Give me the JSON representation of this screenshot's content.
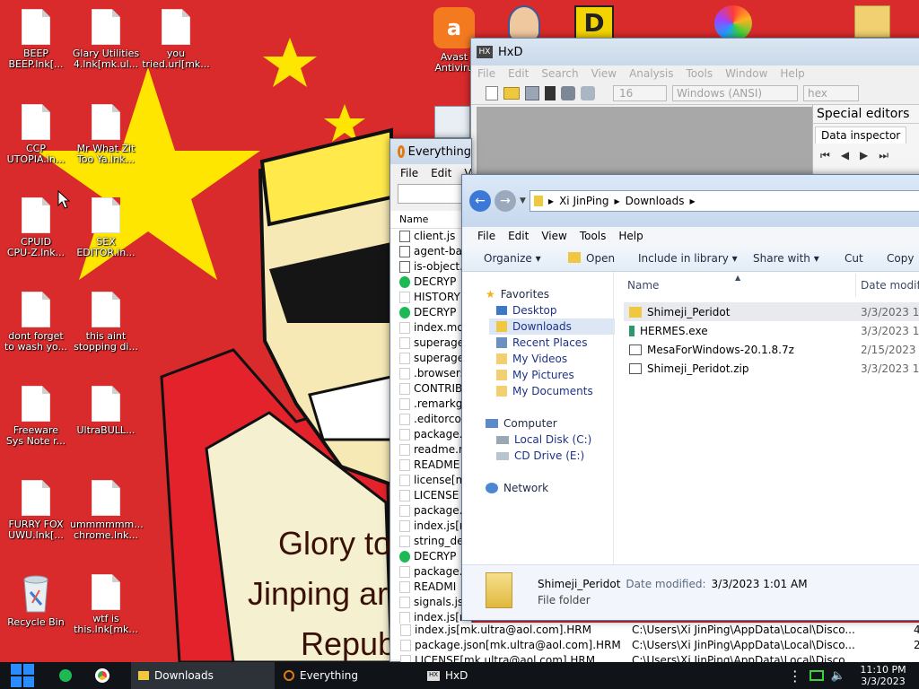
{
  "theme": {
    "wallpaper_red": "#d92b2c",
    "star_yellow": "#ffe600",
    "taskbar": "#101418",
    "accent": "#3c78d8"
  },
  "desktop": {
    "icons": [
      {
        "label": "BEEP\nBEEP.lnk[..."
      },
      {
        "label": "Glary Utilities\n4.lnk[mk.ul..."
      },
      {
        "label": "you\ntried.url[mk..."
      },
      {
        "label": "CCP\nUTOPIA.ln..."
      },
      {
        "label": "Mr What Zit\nToo Ya.lnk..."
      },
      {
        "label": "CPUID\nCPU-Z.lnk..."
      },
      {
        "label": "SEX\nEDITOR.ln..."
      },
      {
        "label": "dont forget\nto wash yo..."
      },
      {
        "label": "this aint\nstopping di..."
      },
      {
        "label": "Freeware\nSys Note r..."
      },
      {
        "label": "UltraBULL..."
      },
      {
        "label": "FURRY FOX\nUWU.lnk[..."
      },
      {
        "label": "ummmmmm...\nchrome.lnk..."
      },
      {
        "label": "Recycle Bin"
      },
      {
        "label": "wtf is\nthis.lnk[mk..."
      },
      {
        "label": "Avast\nAntiviru"
      }
    ],
    "wallpaper_text": {
      "line1": "Glory to",
      "line2": "Jinping ar",
      "line3": "Repub"
    }
  },
  "hxd": {
    "title": "HxD",
    "menu": [
      "File",
      "Edit",
      "Search",
      "View",
      "Analysis",
      "Tools",
      "Window",
      "Help"
    ],
    "bytes_per_row": "16",
    "encoding": "Windows (ANSI)",
    "display": "hex",
    "special_editors": "Special editors",
    "data_inspector": "Data inspector"
  },
  "everything": {
    "title": "Everything",
    "menu": [
      "File",
      "Edit",
      "V"
    ],
    "col_name": "Name",
    "files": [
      {
        "name": "client.js",
        "icon": "js"
      },
      {
        "name": "agent-ba",
        "icon": "js"
      },
      {
        "name": "is-object.",
        "icon": "js"
      },
      {
        "name": "DECRYP",
        "icon": "green"
      },
      {
        "name": "HISTORY",
        "icon": "file"
      },
      {
        "name": "DECRYP",
        "icon": "green"
      },
      {
        "name": "index.md",
        "icon": "file"
      },
      {
        "name": "superage",
        "icon": "file"
      },
      {
        "name": "superage",
        "icon": "file"
      },
      {
        "name": ".browsers",
        "icon": "file"
      },
      {
        "name": "CONTRIB",
        "icon": "file"
      },
      {
        "name": ".remarkg",
        "icon": "file"
      },
      {
        "name": ".editorco",
        "icon": "file"
      },
      {
        "name": "package.",
        "icon": "file"
      },
      {
        "name": "readme.m",
        "icon": "file"
      },
      {
        "name": "README",
        "icon": "file"
      },
      {
        "name": "license[m",
        "icon": "file"
      },
      {
        "name": "LICENSE",
        "icon": "file"
      },
      {
        "name": "package.",
        "icon": "file"
      },
      {
        "name": "index.js[n",
        "icon": "file"
      },
      {
        "name": "string_dec",
        "icon": "file"
      },
      {
        "name": "DECRYP",
        "icon": "green"
      },
      {
        "name": "package.",
        "icon": "file"
      },
      {
        "name": "READMI",
        "icon": "file"
      },
      {
        "name": "signals.js",
        "icon": "file"
      },
      {
        "name": "index.js[n",
        "icon": "file"
      }
    ],
    "bottom_rows": [
      {
        "name": "index.js[mk.ultra@aol.com].HRM",
        "path": "C:\\Users\\Xi JinPing\\AppData\\Local\\Disco...",
        "extra": "4"
      },
      {
        "name": "package.json[mk.ultra@aol.com].HRM",
        "path": "C:\\Users\\Xi JinPing\\AppData\\Local\\Disco...",
        "extra": "2"
      },
      {
        "name": "LICENSE[mk.ultra@aol.com].HRM",
        "path": "C:\\Users\\Xi JinPing\\AppData\\Local\\Disco...",
        "extra": ""
      }
    ]
  },
  "explorer": {
    "breadcrumb": [
      "Xi JinPing",
      "Downloads"
    ],
    "menu": [
      "File",
      "Edit",
      "View",
      "Tools",
      "Help"
    ],
    "toolbar": {
      "organize": "Organize",
      "open": "Open",
      "include": "Include in library",
      "share": "Share with",
      "cut": "Cut",
      "copy": "Copy"
    },
    "nav": {
      "favorites": "Favorites",
      "fav_items": [
        "Desktop",
        "Downloads",
        "Recent Places",
        "My Videos",
        "My Pictures",
        "My Documents"
      ],
      "computer": "Computer",
      "comp_items": [
        "Local Disk (C:)",
        "CD Drive (E:)"
      ],
      "network": "Network"
    },
    "columns": {
      "name": "Name",
      "date": "Date modifi"
    },
    "files": [
      {
        "name": "Shimeji_Peridot",
        "date": "3/3/2023 1:",
        "icon": "folder"
      },
      {
        "name": "HERMES.exe",
        "date": "3/3/2023 1:",
        "icon": "exe"
      },
      {
        "name": "MesaForWindows-20.1.8.7z",
        "date": "2/15/2023 2",
        "icon": "archive"
      },
      {
        "name": "Shimeji_Peridot.zip",
        "date": "3/3/2023 1:",
        "icon": "archive"
      }
    ],
    "details": {
      "name": "Shimeji_Peridot",
      "date_label": "Date modified:",
      "date_value": "3/3/2023 1:01 AM",
      "type": "File folder"
    }
  },
  "taskbar": {
    "tasks": [
      {
        "label": "Downloads"
      },
      {
        "label": "Everything"
      },
      {
        "label": "HxD"
      }
    ],
    "time": "11:10 PM",
    "date": "3/3/2023"
  }
}
